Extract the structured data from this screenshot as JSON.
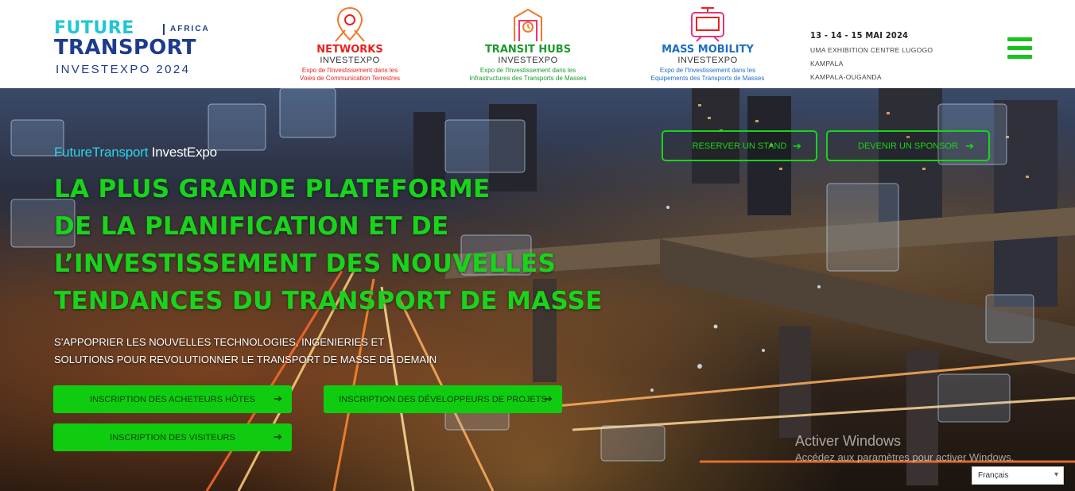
{
  "header": {
    "logo": {
      "line1": "FUTURE",
      "region": "AFRICA",
      "line2": "TRANSPORT",
      "line3": "INVESTEXPO 2024"
    },
    "sub_logos": [
      {
        "name": "NETWORKS",
        "expo": "INVESTEXPO",
        "desc1": "Expo de l'Investissement dans les",
        "desc2": "Voies de Communication Terrestres",
        "color": "#e8231f",
        "icon": "map-pin-network-icon"
      },
      {
        "name": "TRANSIT HUBS",
        "expo": "INVESTEXPO",
        "desc1": "Expo de l'Investissement dans les",
        "desc2": "Infrastructures des Transports de Masses",
        "color": "#1a9a2c",
        "icon": "station-clock-icon"
      },
      {
        "name": "MASS MOBILITY",
        "expo": "INVESTEXPO",
        "desc1": "Expo de l'Investissement dans les",
        "desc2": "Equipements des Transports de Masses",
        "color": "#1d6fc4",
        "icon": "tram-car-icon"
      }
    ],
    "event": {
      "dates": "13 - 14 - 15 MAI 2024",
      "venue1": "UMA EXHIBITION CENTRE LUGOGO KAMPALA",
      "venue2": "KAMPALA-OUGANDA"
    },
    "menu_icon": "hamburger-menu-icon"
  },
  "hero": {
    "kicker_highlight": "FutureTransport",
    "kicker_rest": " InvestExpo",
    "headline": [
      "LA PLUS GRANDE PLATEFORME",
      "DE LA PLANIFICATION ET DE",
      "L’INVESTISSEMENT DES NOUVELLES",
      "TENDANCES DU TRANSPORT DE MASSE"
    ],
    "subtitle": [
      "S’APPOPRIER LES NOUVELLES TECHNOLOGIES, INGENIERIES ET",
      "SOLUTIONS POUR REVOLUTIONNER LE TRANSPORT DE MASSE DE DEMAIN"
    ],
    "buttons": {
      "buyers": "INSCRIPTION DES ACHETEURS HÔTES",
      "developers": "INSCRIPTION DES DÉVELOPPEURS DE PROJETS",
      "visitors": "INSCRIPTION DES VISITEURS",
      "stand": "RESERVER UN STAND",
      "sponsor": "DEVENIR UN SPONSOR",
      "arrow": "➔"
    },
    "accent_color": "#18d41a"
  },
  "windows_watermark": {
    "title": "Activer Windows",
    "subtitle": "Accédez aux paramètres pour activer Windows."
  },
  "language": {
    "selected": "Français",
    "chevron": "▾"
  }
}
